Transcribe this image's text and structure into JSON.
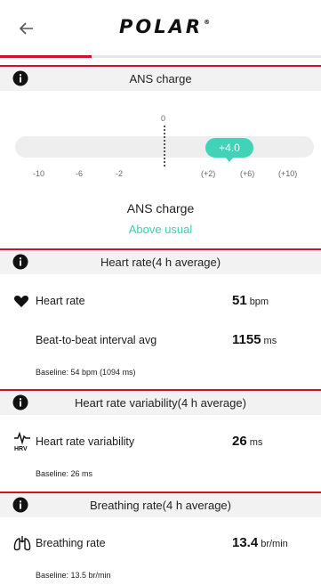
{
  "header": {
    "logo_text": "POLAR",
    "logo_mark": "®",
    "progress_fraction": 0.285
  },
  "ans": {
    "section_title": "ANS charge",
    "zero_label": "0",
    "value_label": "+4.0",
    "value": 4.0,
    "ticks": [
      "-10",
      "-6",
      "-2",
      "(+2)",
      "(+6)",
      "(+10)"
    ],
    "center_title": "ANS charge",
    "center_status": "Above usual",
    "accent_color": "#40d3b8"
  },
  "heart": {
    "section_title": "Heart rate(4 h average)",
    "rows": [
      {
        "label": "Heart rate",
        "value": "51",
        "unit": "bpm"
      },
      {
        "label": "Beat-to-beat interval avg",
        "value": "1155",
        "unit": "ms"
      }
    ],
    "baseline": "Baseline: 54 bpm (1094 ms)"
  },
  "hrv": {
    "section_title": "Heart rate variability(4 h average)",
    "icon_text": "HRV",
    "rows": [
      {
        "label": "Heart rate variability",
        "value": "26",
        "unit": "ms"
      }
    ],
    "baseline": "Baseline: 26 ms"
  },
  "breathing": {
    "section_title": "Breathing rate(4 h average)",
    "rows": [
      {
        "label": "Breathing rate",
        "value": "13.4",
        "unit": "br/min"
      }
    ],
    "baseline": "Baseline: 13.5 br/min"
  },
  "colors": {
    "brand_red": "#d0112b",
    "accent": "#40d3b8"
  }
}
